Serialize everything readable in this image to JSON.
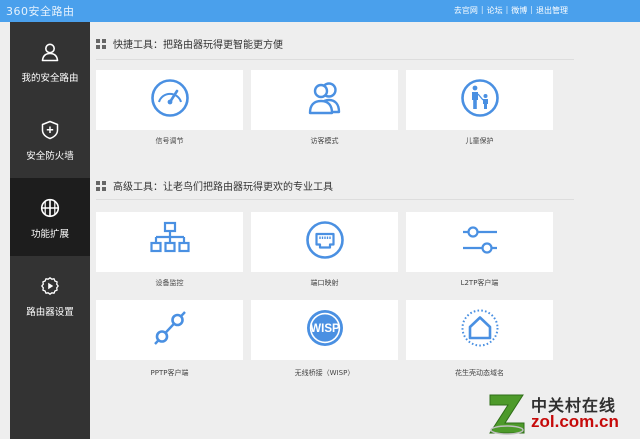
{
  "app": {
    "brand": "360安全路由"
  },
  "top_links": [
    "去官网",
    "论坛",
    "微博",
    "退出管理"
  ],
  "sidebar": {
    "items": [
      {
        "label": "我的安全路由",
        "icon": "user-icon"
      },
      {
        "label": "安全防火墙",
        "icon": "shield-icon"
      },
      {
        "label": "功能扩展",
        "icon": "grid-circle-icon",
        "active": true
      },
      {
        "label": "路由器设置",
        "icon": "gear-play-icon"
      }
    ]
  },
  "quick_tools": {
    "title": "快捷工具：把路由器玩得更智能更方便",
    "cards": [
      {
        "label": "信号调节",
        "icon": "speedometer-icon"
      },
      {
        "label": "访客模式",
        "icon": "users-icon"
      },
      {
        "label": "儿童保护",
        "icon": "family-icon"
      }
    ]
  },
  "advanced_tools": {
    "title": "高级工具：让老鸟们把路由器玩得更欢的专业工具",
    "cards": [
      {
        "label": "设备监控",
        "icon": "network-tree-icon"
      },
      {
        "label": "端口映射",
        "icon": "ethernet-port-icon"
      },
      {
        "label": "L2TP客户端",
        "icon": "sliders-icon"
      },
      {
        "label": "PPTP客户端",
        "icon": "chain-link-icon"
      },
      {
        "label": "无线桥接（WISP）",
        "icon": "wisp-icon"
      },
      {
        "label": "花生壳动态域名",
        "icon": "house-dotted-icon"
      }
    ]
  },
  "watermark": {
    "cn": "中关村在线",
    "en": "zol.com.cn"
  },
  "colors": {
    "accent": "#4a90e2",
    "topbar": "#4aa0ec",
    "sidebar": "#333333",
    "sidebar_active": "#1d1d1d"
  }
}
